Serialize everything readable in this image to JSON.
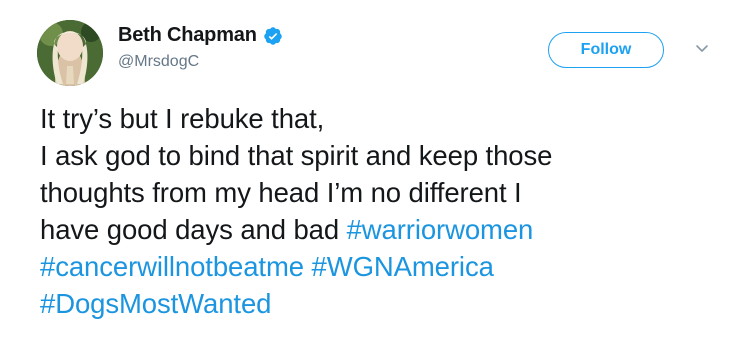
{
  "tweet": {
    "author": {
      "name": "Beth Chapman",
      "handle": "@MrsdogC",
      "verified": true
    },
    "follow_label": "Follow",
    "text_lines": [
      "It try’s but I rebuke that,",
      "I ask god to bind that spirit and keep those",
      "thoughts from my head I’m no different I",
      "have good days and bad "
    ],
    "hashtags": [
      "#warriorwomen",
      "#cancerwillnotbeatme",
      "#WGNAmerica",
      "#DogsMostWanted"
    ]
  },
  "colors": {
    "accent": "#1da1f2",
    "hashtag": "#1b95e0",
    "text": "#14171a",
    "muted": "#657786"
  },
  "icons": [
    "avatar-photo",
    "verified-badge-icon",
    "chevron-down-icon"
  ]
}
